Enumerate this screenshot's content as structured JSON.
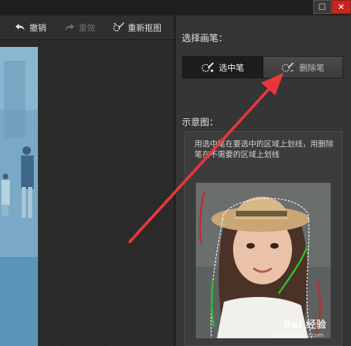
{
  "toolbar": {
    "undo_label": "撤销",
    "redo_label": "重做",
    "rematte_label": "重新抠图"
  },
  "panel": {
    "brush_title": "选择画笔：",
    "select_brush_label": "选中笔",
    "erase_brush_label": "删除笔",
    "preview_title": "示意图：",
    "preview_description": "用选中笔在要选中的区域上划线，用删除笔在不需要的区域上划线"
  },
  "watermark": {
    "main": "Bai 经验",
    "sub": "jingyan.baidu.com"
  },
  "colors": {
    "background": "#2a2a2a",
    "panel": "#353535",
    "close_button": "#c5271f",
    "annotation_arrow": "#e8373a",
    "select_stroke": "#29c42c",
    "erase_stroke": "#c22a2a"
  },
  "icons": {
    "undo": "undo-icon",
    "redo": "redo-icon",
    "rematte": "rematte-icon",
    "select_brush": "select-brush-icon",
    "erase_brush": "erase-brush-icon"
  }
}
